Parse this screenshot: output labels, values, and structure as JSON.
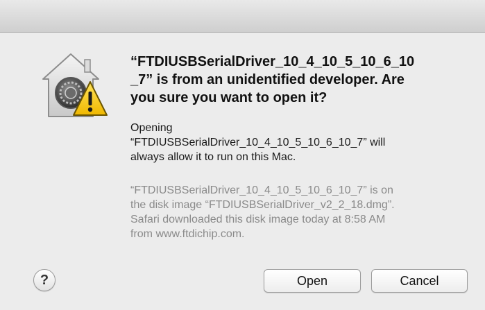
{
  "dialog": {
    "icon": "gatekeeper-house-warning-icon",
    "heading": "“FTDIUSBSerialDriver_10_4_10_5_10_6_10\n_7” is from an unidentified developer. Are\nyou sure you want to open it?",
    "info": "Opening\n“FTDIUSBSerialDriver_10_4_10_5_10_6_10_7” will\nalways allow it to run on this Mac.",
    "source": "“FTDIUSBSerialDriver_10_4_10_5_10_6_10_7” is on\nthe disk image “FTDIUSBSerialDriver_v2_2_18.dmg”.\nSafari downloaded this disk image today at 8:58 AM\nfrom www.ftdichip.com.",
    "help_label": "?",
    "buttons": {
      "open": "Open",
      "cancel": "Cancel"
    }
  },
  "colors": {
    "warning_yellow": "#f6cf2f",
    "secondary_text": "#8a8a8a"
  }
}
